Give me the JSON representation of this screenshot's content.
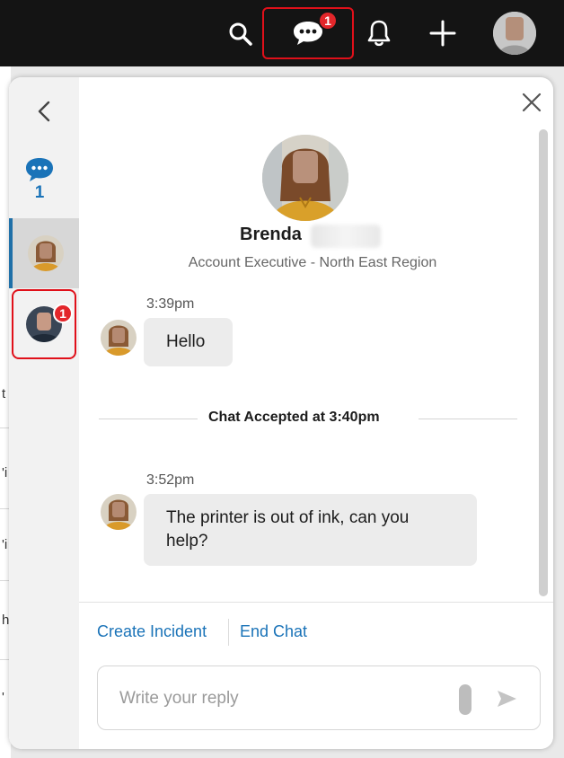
{
  "topbar": {
    "icons": [
      "search-icon",
      "chat-icon",
      "bell-icon",
      "plus-icon",
      "user-avatar"
    ],
    "chat_badge": "1"
  },
  "background_page": {
    "chars": [
      "t",
      "'i",
      "'i",
      "h",
      "'"
    ]
  },
  "sidebar": {
    "back_icon": "chevron-left-icon",
    "chat_icon": "chat-bubble-icon",
    "chat_count": "1",
    "pending_badge": "1"
  },
  "profile": {
    "name": "Brenda",
    "title": "Account Executive - North East Region"
  },
  "messages": [
    {
      "time": "3:39pm",
      "text": "Hello"
    },
    {
      "time": "3:52pm",
      "text": "The printer is out of ink, can you help?"
    }
  ],
  "divider": "Chat Accepted at 3:40pm",
  "actions": {
    "create_incident": "Create Incident",
    "end_chat": "End Chat"
  },
  "reply": {
    "placeholder": "Write your reply"
  },
  "colors": {
    "link": "#1a73b8",
    "badge": "#e3262a",
    "highlight": "#e0101a",
    "topbar": "#141414"
  }
}
